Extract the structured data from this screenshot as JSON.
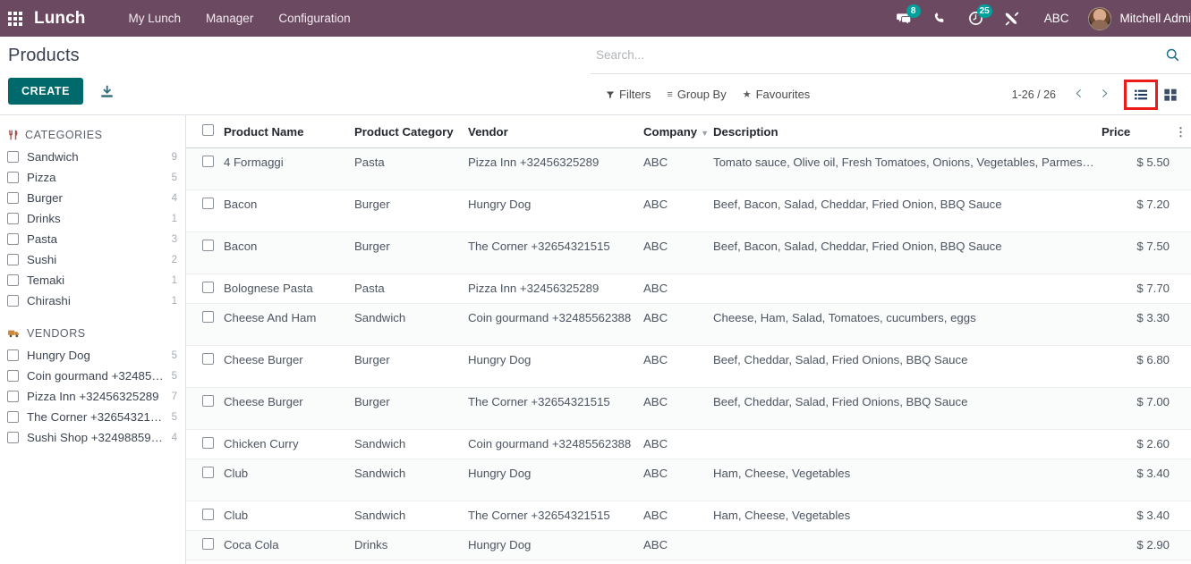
{
  "navbar": {
    "apps_icon": "apps-grid-icon",
    "brand": "Lunch",
    "menu": [
      {
        "label": "My Lunch"
      },
      {
        "label": "Manager"
      },
      {
        "label": "Configuration"
      }
    ],
    "messages_icon": "messages-icon",
    "messages_count": "8",
    "phone_icon": "phone-icon",
    "activities_icon": "activities-clock-icon",
    "activities_count": "25",
    "tools_icon": "tools-icon",
    "company": "ABC",
    "user_name": "Mitchell Admi",
    "brand_color": "#6b4a61",
    "badge_color": "#00A09D"
  },
  "control_panel": {
    "title": "Products",
    "create_label": "CREATE",
    "import_icon": "import-download-icon",
    "search": {
      "placeholder": "Search...",
      "value": "",
      "icon": "search-magnifier-icon"
    },
    "filters_label": "Filters",
    "filters_icon": "filter-funnel-icon",
    "group_by_label": "Group By",
    "group_by_icon": "hamburger-lines-icon",
    "favourites_label": "Favourites",
    "favourites_icon": "star-icon",
    "pager": "1-26 / 26",
    "prev_icon": "chevron-left-icon",
    "next_icon": "chevron-right-icon",
    "view_list_icon": "list-view-icon",
    "view_kanban_icon": "kanban-view-icon",
    "active_view": "list",
    "highlight_color": "#ee1b1b",
    "create_color": "#00696b"
  },
  "sidebar": {
    "categories": {
      "title": "CATEGORIES",
      "icon": "cutlery-icon",
      "items": [
        {
          "label": "Sandwich",
          "count": "9"
        },
        {
          "label": "Pizza",
          "count": "5"
        },
        {
          "label": "Burger",
          "count": "4"
        },
        {
          "label": "Drinks",
          "count": "1"
        },
        {
          "label": "Pasta",
          "count": "3"
        },
        {
          "label": "Sushi",
          "count": "2"
        },
        {
          "label": "Temaki",
          "count": "1"
        },
        {
          "label": "Chirashi",
          "count": "1"
        }
      ]
    },
    "vendors": {
      "title": "VENDORS",
      "icon": "truck-icon",
      "items": [
        {
          "label": "Hungry Dog",
          "count": "5"
        },
        {
          "label": "Coin gourmand +324855...",
          "count": "5"
        },
        {
          "label": "Pizza Inn +32456325289",
          "count": "7"
        },
        {
          "label": "The Corner +326543215...",
          "count": "5"
        },
        {
          "label": "Sushi Shop +324988599...",
          "count": "4"
        }
      ]
    }
  },
  "table": {
    "columns": {
      "name": "Product Name",
      "category": "Product Category",
      "vendor": "Vendor",
      "company": "Company",
      "description": "Description",
      "price": "Price",
      "options_icon": "column-options-icon",
      "company_sort_icon": "sort-caret-icon"
    },
    "rows": [
      {
        "name": "4 Formaggi",
        "category": "Pasta",
        "vendor": "Pizza Inn +32456325289",
        "company": "ABC",
        "description": "Tomato sauce, Olive oil, Fresh Tomatoes, Onions, Vegetables, Parmesan",
        "price": "$ 5.50"
      },
      {
        "name": "Bacon",
        "category": "Burger",
        "vendor": "Hungry Dog",
        "company": "ABC",
        "description": "Beef, Bacon, Salad, Cheddar, Fried Onion, BBQ Sauce",
        "price": "$ 7.20"
      },
      {
        "name": "Bacon",
        "category": "Burger",
        "vendor": "The Corner +32654321515",
        "company": "ABC",
        "description": "Beef, Bacon, Salad, Cheddar, Fried Onion, BBQ Sauce",
        "price": "$ 7.50"
      },
      {
        "name": "Bolognese Pasta",
        "category": "Pasta",
        "vendor": "Pizza Inn +32456325289",
        "company": "ABC",
        "description": "",
        "price": "$ 7.70"
      },
      {
        "name": "Cheese And Ham",
        "category": "Sandwich",
        "vendor": "Coin gourmand +32485562388",
        "company": "ABC",
        "description": "Cheese, Ham, Salad, Tomatoes, cucumbers, eggs",
        "price": "$ 3.30"
      },
      {
        "name": "Cheese Burger",
        "category": "Burger",
        "vendor": "Hungry Dog",
        "company": "ABC",
        "description": "Beef, Cheddar, Salad, Fried Onions, BBQ Sauce",
        "price": "$ 6.80"
      },
      {
        "name": "Cheese Burger",
        "category": "Burger",
        "vendor": "The Corner +32654321515",
        "company": "ABC",
        "description": "Beef, Cheddar, Salad, Fried Onions, BBQ Sauce",
        "price": "$ 7.00"
      },
      {
        "name": "Chicken Curry",
        "category": "Sandwich",
        "vendor": "Coin gourmand +32485562388",
        "company": "ABC",
        "description": "",
        "price": "$ 2.60"
      },
      {
        "name": "Club",
        "category": "Sandwich",
        "vendor": "Hungry Dog",
        "company": "ABC",
        "description": "Ham, Cheese, Vegetables",
        "price": "$ 3.40"
      },
      {
        "name": "Club",
        "category": "Sandwich",
        "vendor": "The Corner +32654321515",
        "company": "ABC",
        "description": "Ham, Cheese, Vegetables",
        "price": "$ 3.40"
      },
      {
        "name": "Coca Cola",
        "category": "Drinks",
        "vendor": "Hungry Dog",
        "company": "ABC",
        "description": "",
        "price": "$ 2.90"
      }
    ]
  }
}
